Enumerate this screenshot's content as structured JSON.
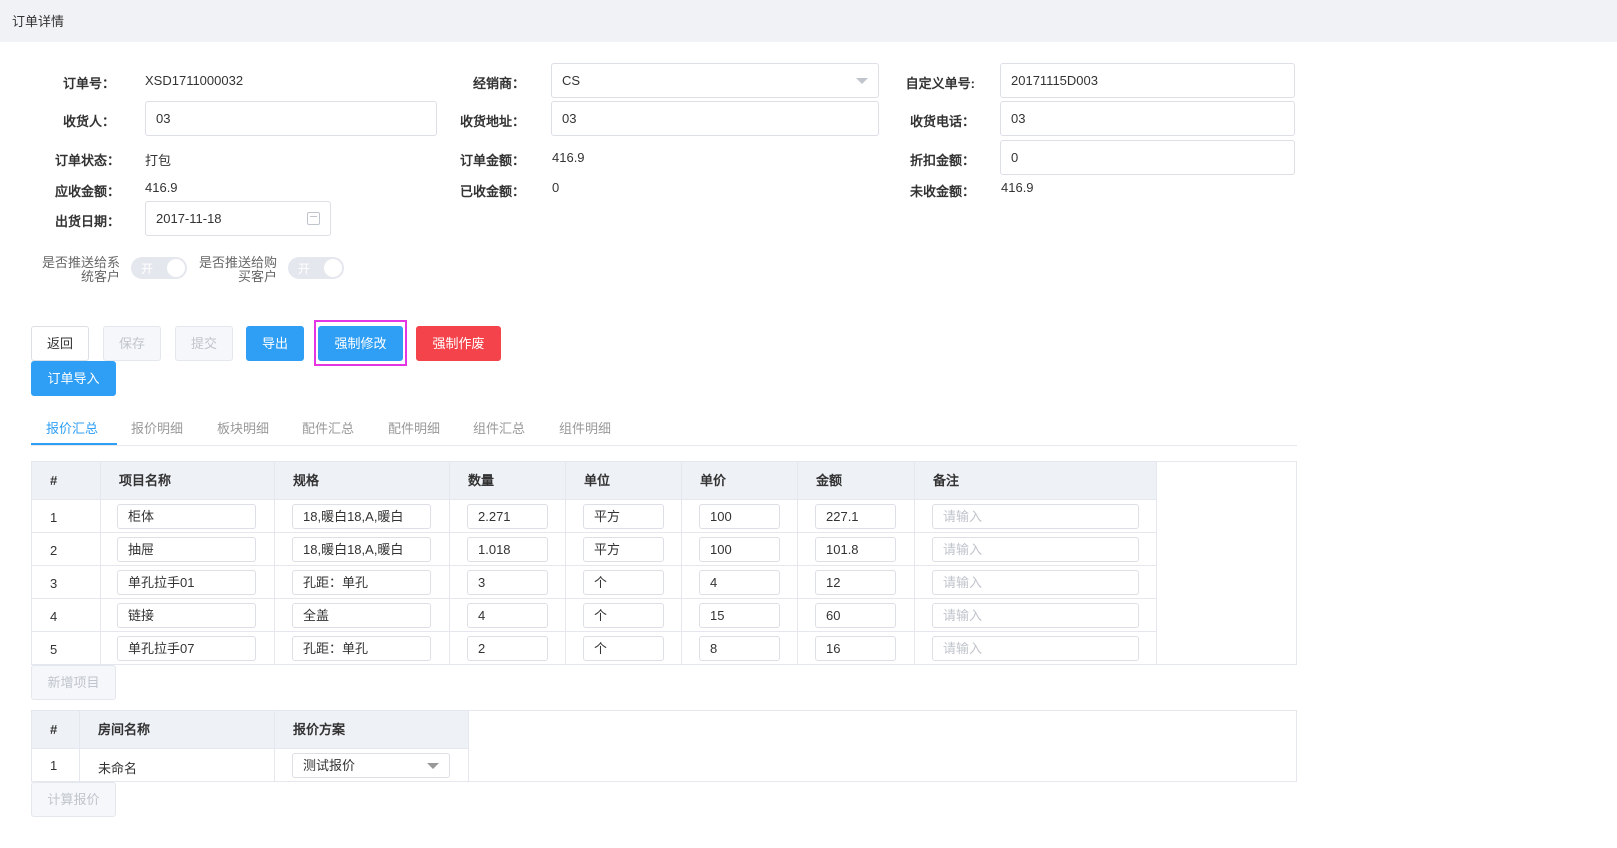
{
  "page": {
    "title": "订单详情"
  },
  "form": {
    "order_no_label": "订单号：",
    "order_no": "XSD1711000032",
    "dealer_label": "经销商：",
    "dealer": "CS",
    "custom_no_label": "自定义单号:",
    "custom_no": "20171115D003",
    "receiver_label": "收货人：",
    "receiver": "03",
    "address_label": "收货地址：",
    "address": "03",
    "phone_label": "收货电话：",
    "phone": "03",
    "status_label": "订单状态：",
    "status": "打包",
    "amount_label": "订单金额：",
    "amount": "416.9",
    "discount_label": "折扣金额：",
    "discount": "0",
    "receivable_label": "应收金额：",
    "receivable": "416.9",
    "received_label": "已收金额：",
    "received": "0",
    "unreceived_label": "未收金额：",
    "unreceived": "416.9",
    "ship_date_label": "出货日期：",
    "ship_date": "2017-11-18",
    "push_system_label_1": "是否推送给系",
    "push_system_label_2": "统客户",
    "push_buyer_label_1": "是否推送给购",
    "push_buyer_label_2": "买客户",
    "switch_text": "开"
  },
  "actions": {
    "back": "返回",
    "save": "保存",
    "submit": "提交",
    "export": "导出",
    "force_edit": "强制修改",
    "force_void": "强制作废",
    "import": "订单导入"
  },
  "tabs": [
    "报价汇总",
    "报价明细",
    "板块明细",
    "配件汇总",
    "配件明细",
    "组件汇总",
    "组件明细"
  ],
  "items_table": {
    "headers": [
      "#",
      "项目名称",
      "规格",
      "数量",
      "单位",
      "单价",
      "金额",
      "备注"
    ],
    "placeholder": "请输入",
    "rows": [
      {
        "no": "1",
        "name": "柜体",
        "spec": "18,暖白18,A,暖白",
        "qty": "2.271",
        "unit": "平方",
        "price": "100",
        "amount": "227.1"
      },
      {
        "no": "2",
        "name": "抽屉",
        "spec": "18,暖白18,A,暖白",
        "qty": "1.018",
        "unit": "平方",
        "price": "100",
        "amount": "101.8"
      },
      {
        "no": "3",
        "name": "单孔拉手01",
        "spec": "孔距：单孔",
        "qty": "3",
        "unit": "个",
        "price": "4",
        "amount": "12"
      },
      {
        "no": "4",
        "name": "链接",
        "spec": "全盖",
        "qty": "4",
        "unit": "个",
        "price": "15",
        "amount": "60"
      },
      {
        "no": "5",
        "name": "单孔拉手07",
        "spec": "孔距：单孔",
        "qty": "2",
        "unit": "个",
        "price": "8",
        "amount": "16"
      }
    ],
    "add_button": "新增项目"
  },
  "rooms_table": {
    "headers": [
      "#",
      "房间名称",
      "报价方案"
    ],
    "rows": [
      {
        "no": "1",
        "name": "未命名",
        "plan": "测试报价"
      }
    ],
    "calc_button": "计算报价"
  }
}
